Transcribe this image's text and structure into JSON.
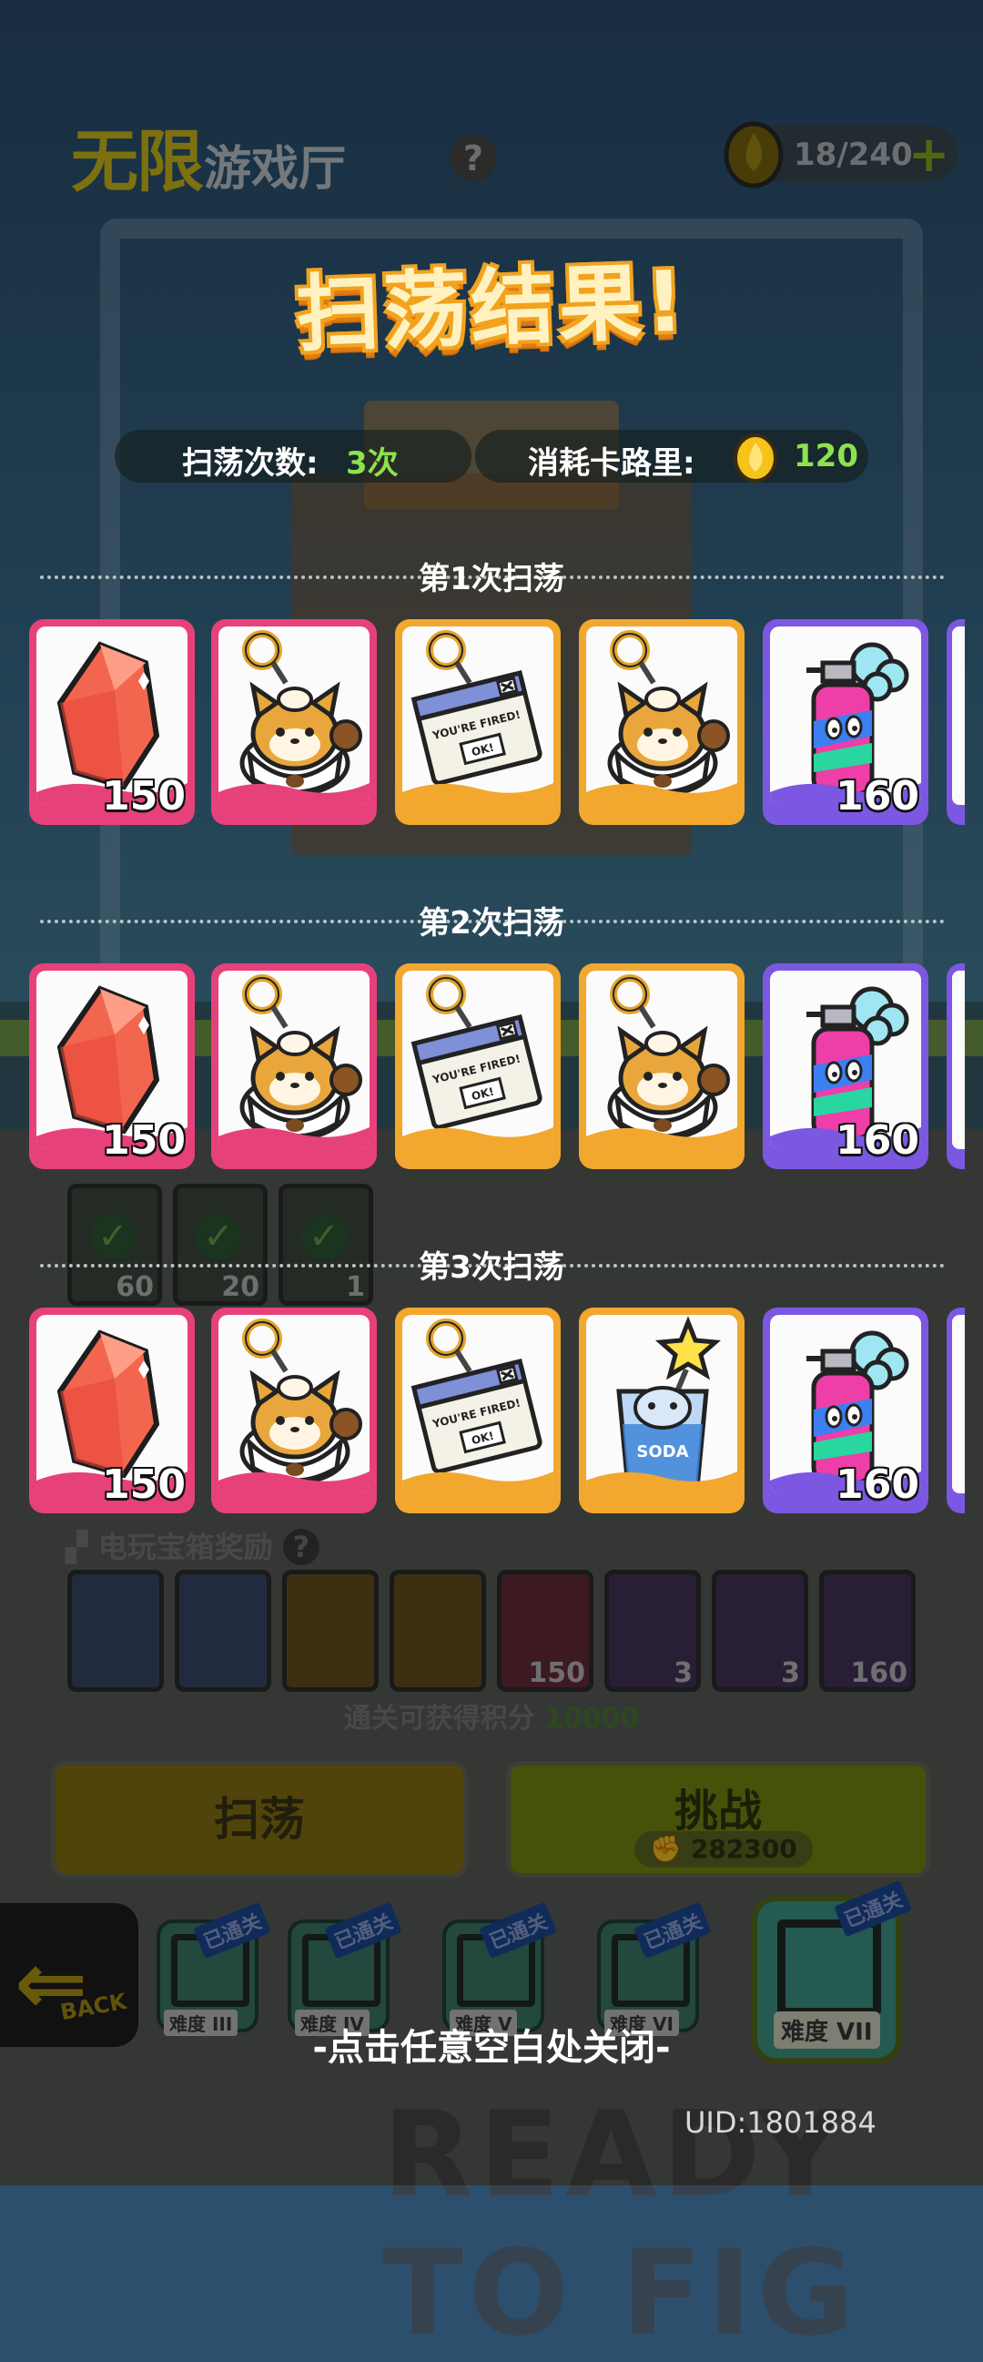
{
  "header": {
    "hall_title_big": "无限",
    "hall_title_small": "游戏厅",
    "help": "?",
    "energy": "18/240",
    "energy_plus": "+"
  },
  "popup": {
    "title": "扫荡结果!",
    "sweep_count_label": "扫荡次数:",
    "sweep_count_value": "3次",
    "cost_label": "消耗卡路里:",
    "cost_value": "120",
    "rounds": [
      {
        "label": "第1次扫荡",
        "items": [
          {
            "name": "red-crystal",
            "frame": "pink",
            "qty": "150"
          },
          {
            "name": "shiba-cup-keychain",
            "frame": "pink",
            "qty": ""
          },
          {
            "name": "youre-fired-keychain",
            "frame": "orange",
            "qty": ""
          },
          {
            "name": "shiba-cup-keychain",
            "frame": "orange",
            "qty": ""
          },
          {
            "name": "spray-can",
            "frame": "purple",
            "qty": "160"
          }
        ]
      },
      {
        "label": "第2次扫荡",
        "items": [
          {
            "name": "red-crystal",
            "frame": "pink",
            "qty": "150"
          },
          {
            "name": "shiba-cup-keychain",
            "frame": "pink",
            "qty": ""
          },
          {
            "name": "youre-fired-keychain",
            "frame": "orange",
            "qty": ""
          },
          {
            "name": "shiba-cup-keychain",
            "frame": "orange",
            "qty": ""
          },
          {
            "name": "spray-can",
            "frame": "purple",
            "qty": "160"
          }
        ]
      },
      {
        "label": "第3次扫荡",
        "items": [
          {
            "name": "red-crystal",
            "frame": "pink",
            "qty": "150"
          },
          {
            "name": "shiba-cup-keychain",
            "frame": "pink",
            "qty": ""
          },
          {
            "name": "youre-fired-keychain",
            "frame": "orange",
            "qty": ""
          },
          {
            "name": "star-drink-keychain",
            "frame": "orange",
            "qty": ""
          },
          {
            "name": "spray-can",
            "frame": "purple",
            "qty": "160"
          }
        ]
      }
    ],
    "fired_text": "YOU'RE FIRED!",
    "ok_text": "OK!",
    "drink_text": "SODA",
    "close_hint": "-点击任意空白处关闭-"
  },
  "background": {
    "tasks": [
      {
        "value": "60"
      },
      {
        "value": "20"
      },
      {
        "value": "1"
      }
    ],
    "chest_title": "电玩宝箱奖励",
    "chest_items": [
      "",
      "",
      "",
      "",
      "150",
      "3",
      "3",
      "160"
    ],
    "score_label": "通关可获得积分",
    "score_value": "10000",
    "sweep_button": "扫荡",
    "challenge_button": "挑战",
    "challenge_cost": "282300",
    "back": "BACK",
    "levels": [
      {
        "badge": "已通关",
        "cap": "难度 III"
      },
      {
        "badge": "已通关",
        "cap": "难度 IV"
      },
      {
        "badge": "已通关",
        "cap": "难度 V"
      },
      {
        "badge": "已通关",
        "cap": "难度 VI"
      },
      {
        "badge": "已通关",
        "cap": "难度 VII"
      }
    ],
    "ready_text": "READY TO FIG",
    "uid": "UID:1801884"
  },
  "colors": {
    "pink_frame": "#e6417b",
    "orange_frame": "#f2a72e",
    "purple_frame": "#7c58e2",
    "highlight_green": "#8de24d",
    "title_orange": "#f2a21d"
  }
}
